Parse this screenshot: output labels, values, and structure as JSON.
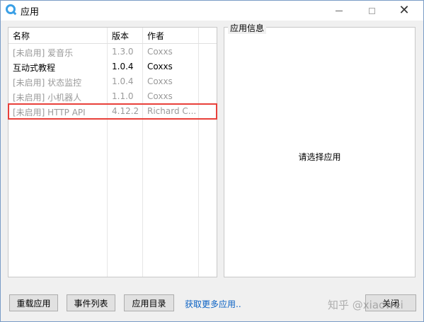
{
  "window": {
    "title": "应用",
    "close_glyph": "✕"
  },
  "list": {
    "columns": [
      "名称",
      "版本",
      "作者"
    ],
    "rows": [
      {
        "name": "[未启用] 爱音乐",
        "version": "1.3.0",
        "author": "Coxxs",
        "enabled": false,
        "selected": false
      },
      {
        "name": "互动式教程",
        "version": "1.0.4",
        "author": "Coxxs",
        "enabled": true,
        "selected": false
      },
      {
        "name": "[未启用] 状态监控",
        "version": "1.0.4",
        "author": "Coxxs",
        "enabled": false,
        "selected": false
      },
      {
        "name": "[未启用] 小机器人",
        "version": "1.1.0",
        "author": "Coxxs",
        "enabled": false,
        "selected": false
      },
      {
        "name": "[未启用] HTTP API",
        "version": "4.12.2",
        "author": "Richard C...",
        "enabled": false,
        "selected": true
      }
    ]
  },
  "info": {
    "title": "应用信息",
    "placeholder": "请选择应用"
  },
  "footer": {
    "reload_label": "重载应用",
    "events_label": "事件列表",
    "dir_label": "应用目录",
    "more_link": "获取更多应用..",
    "close_label": "关闭"
  },
  "watermark": "知乎 @xiaowei",
  "colors": {
    "selection_outline": "#e8403a",
    "link": "#0b62c4",
    "disabled_text": "#9a9a9a"
  }
}
